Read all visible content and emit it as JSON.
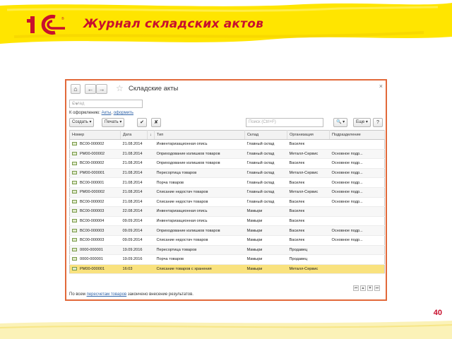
{
  "slide": {
    "title": "Журнал складских актов",
    "page_number": "40",
    "brand_logo_text": "1С"
  },
  "window": {
    "title": "Складские акты",
    "nav_home": "⌂",
    "nav_back": "←",
    "nav_forward": "→",
    "close": "×",
    "search_placeholder": "Склад",
    "search_buttons": "× ▾",
    "formalize_label": "К оформлению:",
    "formalize_link_1": "Акты",
    "formalize_link_2": "оформить",
    "toolbar": {
      "create_label": "Создать ▾",
      "print_label": "Печать ▾",
      "search_placeholder": "Поиск (Ctrl+F)",
      "search_icon": "🔍 ▾",
      "more_label": "Еще ▾",
      "help_label": "?"
    },
    "columns": [
      "Номер",
      "Дата",
      "↓",
      "Тип",
      "Склад",
      "Организация",
      "Подразделение"
    ],
    "rows": [
      {
        "num": "ВС00-000002",
        "date": "21.08.2014",
        "type": "Инвентаризационная опись",
        "store": "Главный склад",
        "org": "Василек",
        "div": ""
      },
      {
        "num": "РМ00-000002",
        "date": "21.08.2014",
        "type": "Оприходование излишков товаров",
        "store": "Главный склад",
        "org": "Металл-Сервис",
        "div": "Основное подр..."
      },
      {
        "num": "ВС00-000002",
        "date": "21.08.2014",
        "type": "Оприходование излишков товаров",
        "store": "Главный склад",
        "org": "Василек",
        "div": "Основное подр..."
      },
      {
        "num": "РМ00-000001",
        "date": "21.08.2014",
        "type": "Пересортица товаров",
        "store": "Главный склад",
        "org": "Металл-Сервис",
        "div": "Основное подр..."
      },
      {
        "num": "ВС00-000001",
        "date": "21.08.2014",
        "type": "Порча товаров",
        "store": "Главный склад",
        "org": "Василек",
        "div": "Основное подр..."
      },
      {
        "num": "РМ00-000002",
        "date": "21.08.2014",
        "type": "Списание недостач товаров",
        "store": "Главный склад",
        "org": "Металл-Сервис",
        "div": "Основное подр..."
      },
      {
        "num": "ВС00-000002",
        "date": "21.08.2014",
        "type": "Списание недостач товаров",
        "store": "Главный склад",
        "org": "Василек",
        "div": "Основное подр..."
      },
      {
        "num": "ВС00-000003",
        "date": "22.08.2014",
        "type": "Инвентаризационная опись",
        "store": "Мамыри",
        "org": "Василек",
        "div": ""
      },
      {
        "num": "ВС00-000004",
        "date": "09.09.2014",
        "type": "Инвентаризационная опись",
        "store": "Мамыри",
        "org": "Василек",
        "div": ""
      },
      {
        "num": "ВС00-000003",
        "date": "09.09.2014",
        "type": "Оприходование излишков товаров",
        "store": "Мамыри",
        "org": "Василек",
        "div": "Основное подр..."
      },
      {
        "num": "ВС00-000003",
        "date": "09.09.2014",
        "type": "Списание недостач товаров",
        "store": "Мамыри",
        "org": "Василек",
        "div": "Основное подр..."
      },
      {
        "num": "0000-000001",
        "date": "19.09.2016",
        "type": "Пересортица товаров",
        "store": "Мамыри",
        "org": "Продавец",
        "div": ""
      },
      {
        "num": "0000-000001",
        "date": "19.09.2016",
        "type": "Порча товаров",
        "store": "Мамыри",
        "org": "Продавец",
        "div": ""
      },
      {
        "num": "РМ00-000001",
        "date": "16:03",
        "type": "Списание товаров с хранения",
        "store": "Мамыри",
        "org": "Металл-Сервис",
        "div": ""
      }
    ],
    "status_prefix": "По всем",
    "status_link": "пересчетам товаров",
    "status_suffix": "закончено внесение результатов."
  },
  "colors": {
    "title": "#c8102e",
    "window_border": "#e2693a",
    "header_yellow": "#ffe500",
    "selected_row": "#f9e27e"
  }
}
